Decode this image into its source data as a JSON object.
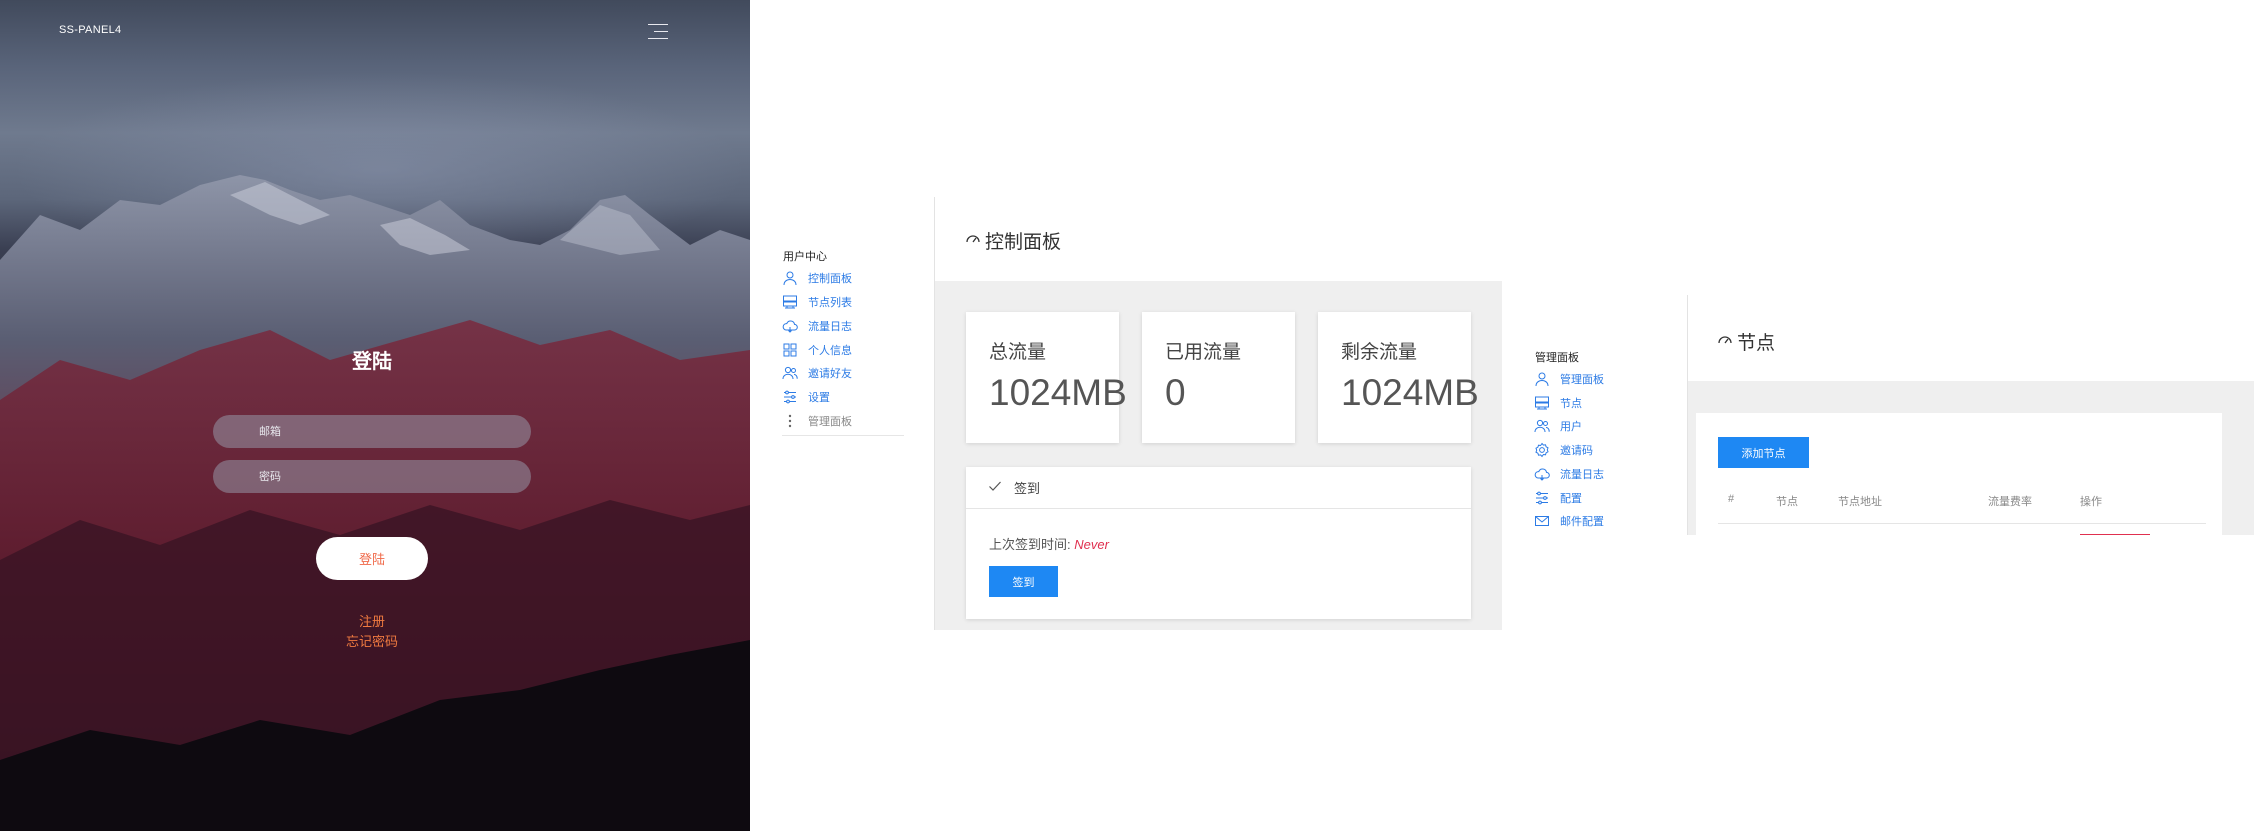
{
  "login": {
    "brand": "SS-PANEL4",
    "title": "登陆",
    "email_placeholder": "邮箱",
    "password_placeholder": "密码",
    "submit_label": "登陆",
    "register_link": "注册",
    "forgot_link": "忘记密码"
  },
  "user_sidebar": {
    "title": "用户中心",
    "items": [
      {
        "label": "控制面板",
        "icon": "user-icon"
      },
      {
        "label": "节点列表",
        "icon": "server-icon"
      },
      {
        "label": "流量日志",
        "icon": "cloud-icon"
      },
      {
        "label": "个人信息",
        "icon": "grid-icon"
      },
      {
        "label": "邀请好友",
        "icon": "users-icon"
      },
      {
        "label": "设置",
        "icon": "sliders-icon"
      },
      {
        "label": "管理面板",
        "icon": "more-vertical-icon"
      }
    ]
  },
  "dashboard": {
    "title": "控制面板",
    "stats": [
      {
        "label": "总流量",
        "value": "1024MB"
      },
      {
        "label": "已用流量",
        "value": "0"
      },
      {
        "label": "剩余流量",
        "value": "1024MB"
      }
    ],
    "checkin": {
      "header": "签到",
      "last_label": "上次签到时间:",
      "last_value": "Never",
      "button_label": "签到"
    }
  },
  "admin_sidebar": {
    "title": "管理面板",
    "items": [
      {
        "label": "管理面板",
        "icon": "user-icon"
      },
      {
        "label": "节点",
        "icon": "server-icon"
      },
      {
        "label": "用户",
        "icon": "users-icon"
      },
      {
        "label": "邀请码",
        "icon": "settings-icon"
      },
      {
        "label": "流量日志",
        "icon": "cloud-icon"
      },
      {
        "label": "配置",
        "icon": "sliders-icon"
      },
      {
        "label": "邮件配置",
        "icon": "mail-icon"
      }
    ]
  },
  "nodes": {
    "title": "节点",
    "add_button": "添加节点",
    "columns": [
      "#",
      "节点",
      "节点地址",
      "流量费率",
      "操作"
    ]
  },
  "colors": {
    "accent_blue": "#1e88f3",
    "link_blue": "#2c7be5",
    "login_link_orange": "#f07a40",
    "never_red": "#e0304f"
  }
}
